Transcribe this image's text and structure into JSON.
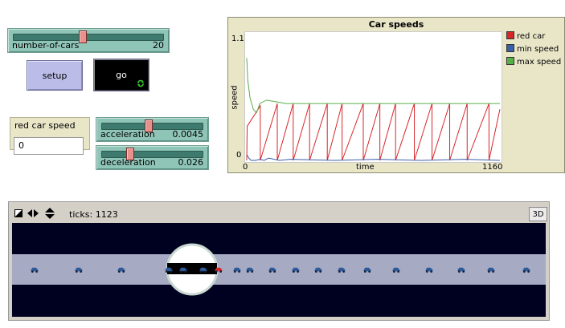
{
  "sliders": {
    "cars": {
      "label": "number-of-cars",
      "value": "20",
      "fraction": 0.45
    },
    "acceleration": {
      "label": "acceleration",
      "value": "0.0045",
      "fraction": 0.45
    },
    "deceleration": {
      "label": "deceleration",
      "value": "0.026",
      "fraction": 0.26
    }
  },
  "buttons": {
    "setup": "setup",
    "go": "go"
  },
  "monitor": {
    "label": "red car speed",
    "value": "0"
  },
  "plot": {
    "title": "Car speeds",
    "xlabel": "time",
    "ylabel": "speed",
    "x_min": "0",
    "x_max": "1160",
    "y_min": "0",
    "y_max": "1.1",
    "legend": [
      {
        "name": "red car",
        "color": "#d7262a"
      },
      {
        "name": "min speed",
        "color": "#3b5ea8"
      },
      {
        "name": "max speed",
        "color": "#55b04a"
      }
    ]
  },
  "view": {
    "ticks_text": "ticks: 1123",
    "btn3d": "3D",
    "toolbar_icons": [
      "edit-icon",
      "speed-left-right-icon",
      "speed-up-down-icon"
    ]
  },
  "chart_data": {
    "type": "line",
    "title": "Car speeds",
    "xlabel": "time",
    "ylabel": "speed",
    "xlim": [
      0,
      1160
    ],
    "ylim": [
      0,
      1.1
    ],
    "series": [
      {
        "name": "red car",
        "color": "#d7262a",
        "x": [
          0,
          2,
          62,
          62,
          140,
          140,
          213,
          213,
          288,
          288,
          369,
          369,
          437,
          437,
          534,
          534,
          610,
          610,
          682,
          682,
          768,
          768,
          849,
          849,
          930,
          930,
          1010,
          1010,
          1110,
          1110,
          1160
        ],
        "y": [
          0,
          0.3,
          0.48,
          0,
          0.5,
          0,
          0.5,
          0,
          0.5,
          0,
          0.5,
          0,
          0.5,
          0,
          0.5,
          0,
          0.5,
          0,
          0.5,
          0,
          0.5,
          0,
          0.5,
          0,
          0.5,
          0,
          0.5,
          0,
          0.5,
          0,
          0.45
        ]
      },
      {
        "name": "min speed",
        "color": "#3b5ea8",
        "x": [
          0,
          10,
          20,
          40,
          60,
          80,
          100,
          150,
          200,
          400,
          600,
          800,
          1000,
          1160
        ],
        "y": [
          0.05,
          0.02,
          0.0,
          0.0,
          0.01,
          0.0,
          0.02,
          0.0,
          0.01,
          0.0,
          0.01,
          0.0,
          0.01,
          0.0
        ]
      },
      {
        "name": "max speed",
        "color": "#55b04a",
        "x": [
          0,
          5,
          15,
          30,
          45,
          60,
          90,
          120,
          180,
          300,
          500,
          700,
          900,
          1100,
          1160
        ],
        "y": [
          0.9,
          0.7,
          0.55,
          0.45,
          0.42,
          0.5,
          0.53,
          0.52,
          0.5,
          0.5,
          0.5,
          0.5,
          0.5,
          0.5,
          0.5
        ]
      }
    ]
  }
}
